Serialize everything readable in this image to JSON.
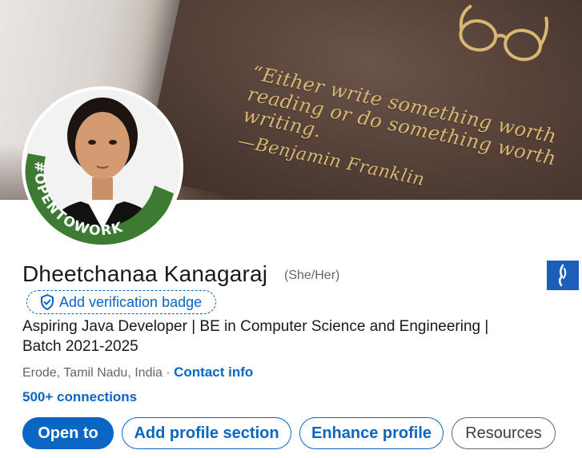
{
  "banner": {
    "quote": "“Either write something worth reading or do something worth writing.",
    "author": "—Benjamin Franklin"
  },
  "avatar": {
    "frame_text": "#OPENTOWORK"
  },
  "profile": {
    "name": "Dheetchanaa Kanagaraj",
    "pronouns": "(She/Her)",
    "verification_label": "Add verification badge",
    "headline": "Aspiring Java Developer | BE in Computer Science and Engineering | Batch 2021-2025",
    "location": "Erode, Tamil Nadu, India",
    "separator": " · ",
    "contact_info": "Contact info",
    "connections": "500+ connections"
  },
  "actions": {
    "open_to": "Open to",
    "add_profile_section": "Add profile section",
    "enhance_profile": "Enhance profile",
    "resources": "Resources"
  },
  "colors": {
    "accent": "#0a66c2",
    "open_to_work_green": "#3d7a32",
    "school_logo_blue": "#1e5eb8"
  },
  "icons": {
    "verification": "shield-check-icon",
    "school": "school-logo-icon"
  }
}
